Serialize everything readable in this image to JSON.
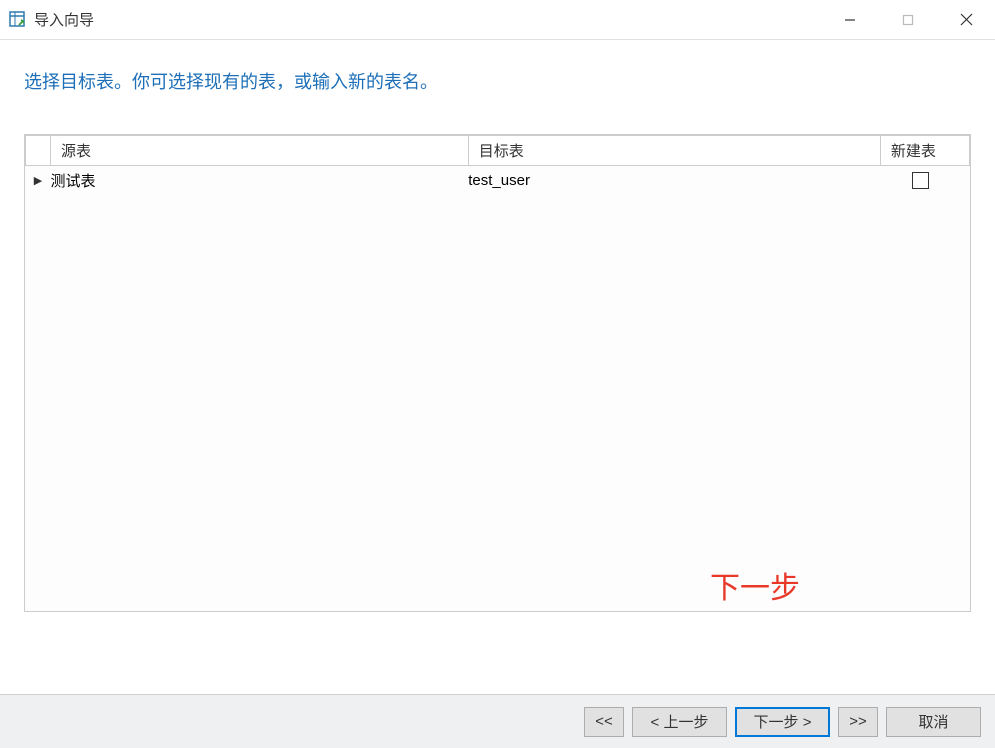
{
  "window": {
    "title": "导入向导"
  },
  "instruction": "选择目标表。你可选择现有的表，或输入新的表名。",
  "table": {
    "headers": {
      "source": "源表",
      "target": "目标表",
      "newtable": "新建表"
    },
    "rows": [
      {
        "indicator": "▶",
        "source": "测试表",
        "target": "test_user",
        "newtable_checked": false
      }
    ]
  },
  "annotation": {
    "next_hint": "下一步"
  },
  "footer": {
    "first": "<<",
    "prev": "< 上一步",
    "next": "下一步 >",
    "last": ">>",
    "cancel": "取消"
  }
}
